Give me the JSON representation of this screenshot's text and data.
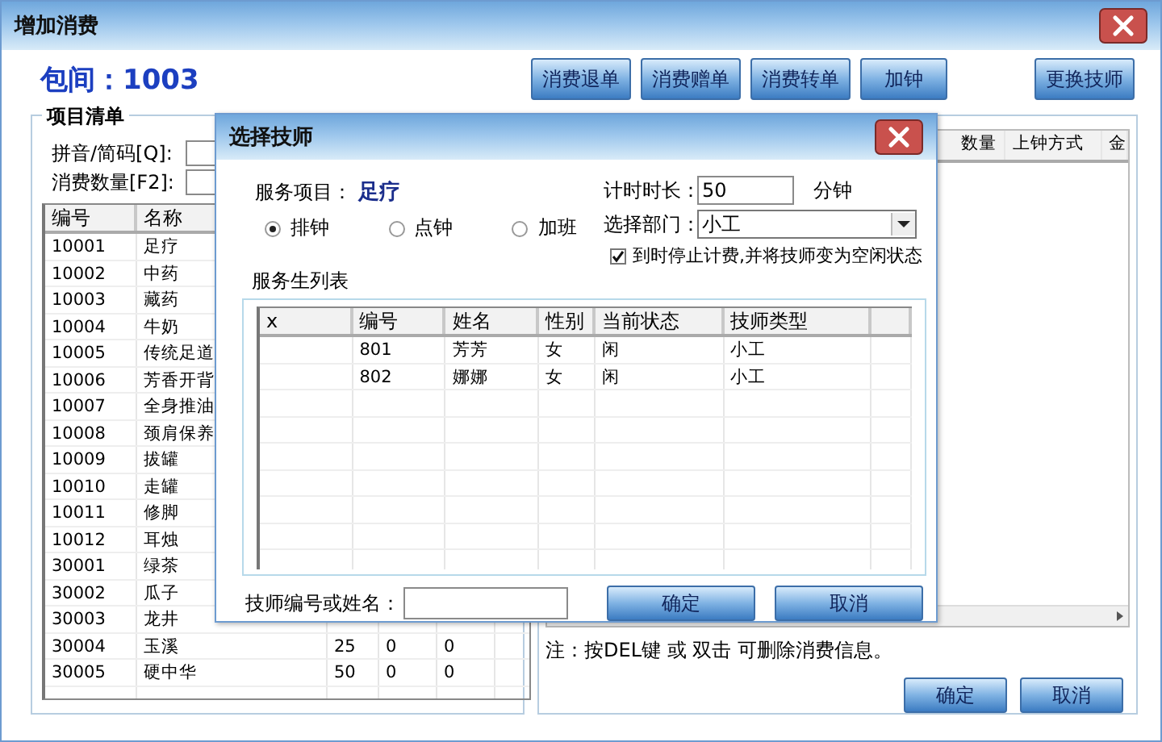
{
  "window": {
    "title": "增加消费"
  },
  "room": {
    "label": "包间：1003"
  },
  "toolbar": [
    "消费退单",
    "消费赠单",
    "消费转单",
    "加钟"
  ],
  "change_button": "更换技师",
  "item_list": {
    "title": "项目清单",
    "fields": [
      {
        "label": "拼音/简码[Q]:"
      },
      {
        "label": "消费数量[F2]:"
      }
    ],
    "columns": [
      "编号",
      "名称"
    ],
    "rows": [
      {
        "cells": [
          "10001",
          "足疗"
        ]
      },
      {
        "cells": [
          "10002",
          "中药"
        ]
      },
      {
        "cells": [
          "10003",
          "藏药"
        ]
      },
      {
        "cells": [
          "10004",
          "牛奶"
        ]
      },
      {
        "cells": [
          "10005",
          "传统足道"
        ]
      },
      {
        "cells": [
          "10006",
          "芳香开背"
        ]
      },
      {
        "cells": [
          "10007",
          "全身推油"
        ]
      },
      {
        "cells": [
          "10008",
          "颈肩保养"
        ]
      },
      {
        "cells": [
          "10009",
          "拔罐"
        ]
      },
      {
        "cells": [
          "10010",
          "走罐"
        ]
      },
      {
        "cells": [
          "10011",
          "修脚"
        ]
      },
      {
        "cells": [
          "10012",
          "耳烛"
        ]
      },
      {
        "cells": [
          "30001",
          "绿茶"
        ]
      },
      {
        "cells": [
          "30002",
          "瓜子"
        ]
      },
      {
        "cells": [
          "30003",
          "龙井"
        ]
      },
      {
        "cells": [
          "30004",
          "玉溪",
          "25",
          "0",
          "0"
        ]
      },
      {
        "cells": [
          "30005",
          "硬中华",
          "50",
          "0",
          "0"
        ]
      }
    ]
  },
  "consumption_list": {
    "columns": [
      "数量",
      "上钟方式",
      "金"
    ],
    "note": "注：按DEL键 或 双击 可删除消费信息。",
    "buttons": [
      "确定",
      "取消"
    ]
  },
  "dialog": {
    "title": "选择技师",
    "service": {
      "label": "服务项目：",
      "value": "足疗"
    },
    "modes": [
      {
        "label": "排钟",
        "selected": true
      },
      {
        "label": "点钟",
        "selected": false
      },
      {
        "label": "加班",
        "selected": false
      }
    ],
    "duration": {
      "label": "计时时长：",
      "value": "50",
      "unit": "分钟"
    },
    "department": {
      "label": "选择部门：",
      "value": "小工"
    },
    "auto_stop": {
      "label": "到时停止计费,并将技师变为空闲状态",
      "checked": true
    },
    "list_title": "服务生列表",
    "columns": [
      "x",
      "编号",
      "姓名",
      "性别",
      "当前状态",
      "技师类型"
    ],
    "rows": [
      {
        "cells": [
          "",
          "801",
          "芳芳",
          "女",
          "闲",
          "小工"
        ]
      },
      {
        "cells": [
          "",
          "802",
          "娜娜",
          "女",
          "闲",
          "小工"
        ]
      }
    ],
    "search": {
      "label": "技师编号或姓名："
    },
    "buttons": [
      "确定",
      "取消"
    ]
  }
}
